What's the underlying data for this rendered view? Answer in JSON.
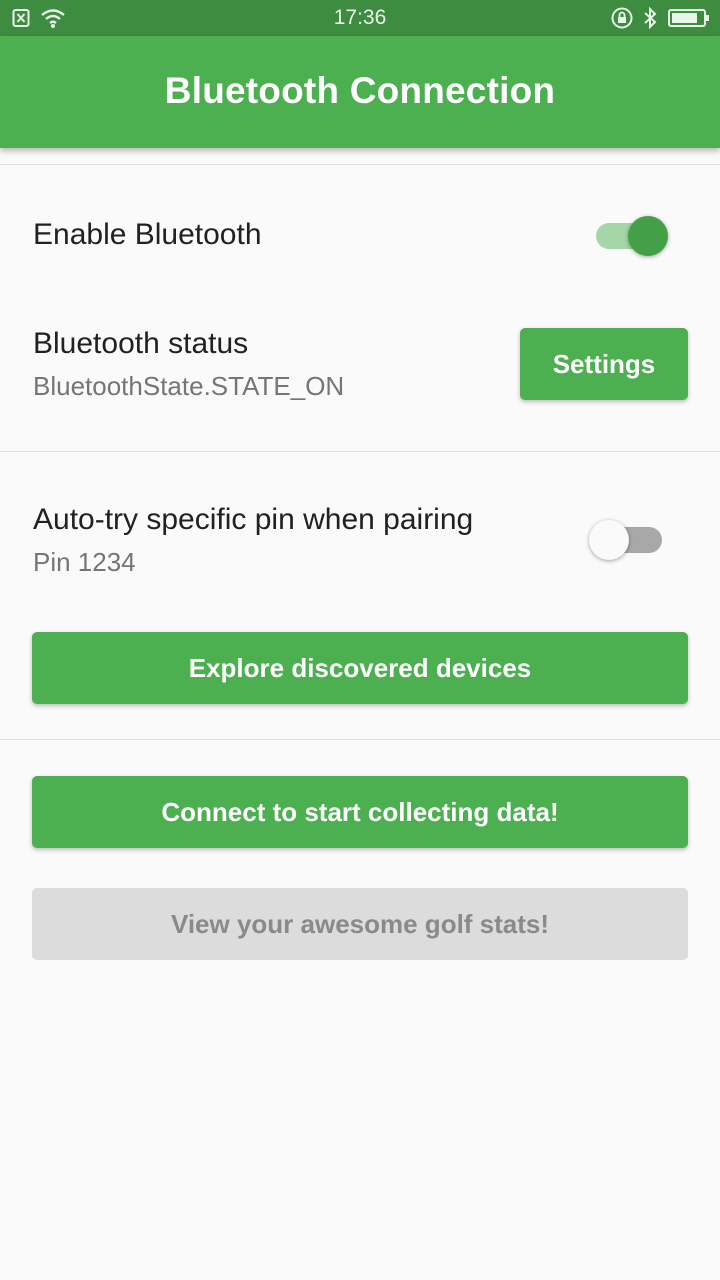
{
  "status_bar": {
    "time": "17:36",
    "left_icons": [
      "notification-x-icon",
      "wifi-icon"
    ],
    "right_icons": [
      "rotation-lock-icon",
      "bluetooth-icon",
      "battery-icon"
    ]
  },
  "app_bar": {
    "title": "Bluetooth Connection",
    "color": "#4caf50"
  },
  "settings": {
    "enable_bluetooth": {
      "label": "Enable Bluetooth",
      "enabled": true
    },
    "bluetooth_status": {
      "label": "Bluetooth status",
      "value": "BluetoothState.STATE_ON",
      "button_label": "Settings"
    },
    "auto_pin": {
      "label": "Auto-try specific pin when pairing",
      "sub": "Pin 1234",
      "enabled": false
    }
  },
  "buttons": {
    "explore": "Explore discovered devices",
    "connect": "Connect to start collecting data!",
    "view_stats": "View your awesome golf stats!"
  },
  "colors": {
    "accent": "#4caf50",
    "accent_dark": "#3d8c40",
    "disabled_bg": "#dcdcdc"
  }
}
